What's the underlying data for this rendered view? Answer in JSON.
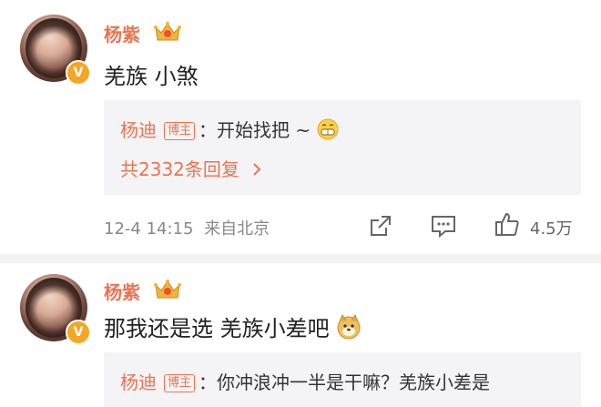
{
  "comments": [
    {
      "username": "杨紫",
      "text": "羌族 小煞",
      "reply": {
        "name": "杨迪",
        "tag": "博主",
        "text": "：开始找把 ~"
      },
      "reply_count": "共2332条回复",
      "time": "12-4 14:15",
      "location": "来自北京",
      "likes": "4.5万",
      "icons": [
        "verified-v-icon",
        "crown-badge-icon",
        "grin-emoji",
        "chevron-right-icon",
        "share-icon",
        "comment-icon",
        "thumbs-up-icon"
      ]
    },
    {
      "username": "杨紫",
      "text": "那我还是选 羌族小差吧",
      "reply": {
        "name": "杨迪",
        "tag": "博主",
        "text": "：你冲浪冲一半是干嘛？羌族小差是"
      },
      "icons": [
        "verified-v-icon",
        "crown-badge-icon",
        "doge-emoji"
      ]
    }
  ],
  "colors": {
    "accent": "#eb7350",
    "reply_bg": "#f4f4f6",
    "verified": "#f5a623"
  }
}
